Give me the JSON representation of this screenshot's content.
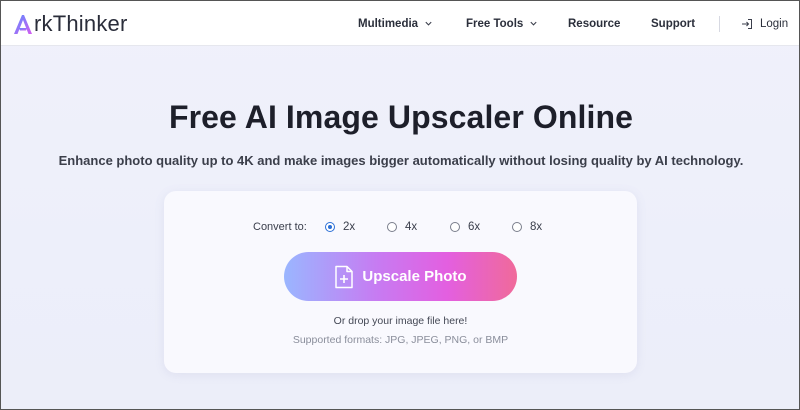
{
  "brand": {
    "logo_letter": "A",
    "logo_text": "rkThinker",
    "colors": {
      "logo_gradient_start": "#5b8cff",
      "logo_gradient_end": "#d45cf0"
    }
  },
  "nav": {
    "items": [
      {
        "label": "Multimedia",
        "has_dropdown": true
      },
      {
        "label": "Free Tools",
        "has_dropdown": true
      },
      {
        "label": "Resource",
        "has_dropdown": false
      },
      {
        "label": "Support",
        "has_dropdown": false
      }
    ],
    "login_label": "Login"
  },
  "hero": {
    "title": "Free AI Image Upscaler Online",
    "subtitle": "Enhance photo quality up to 4K and make images bigger automatically without losing quality by AI technology."
  },
  "converter": {
    "convert_label": "Convert to:",
    "options": [
      {
        "label": "2x",
        "selected": true
      },
      {
        "label": "4x",
        "selected": false
      },
      {
        "label": "6x",
        "selected": false
      },
      {
        "label": "8x",
        "selected": false
      }
    ],
    "upscale_button": "Upscale Photo",
    "drop_text": "Or drop your image file here!",
    "formats_text": "Supported formats: JPG, JPEG, PNG, or BMP",
    "colors": {
      "button_gradient": [
        "#9ab6ff",
        "#c77bf2",
        "#e35fe0",
        "#f06a9a"
      ],
      "radio_selected": "#2b6fd6"
    }
  }
}
